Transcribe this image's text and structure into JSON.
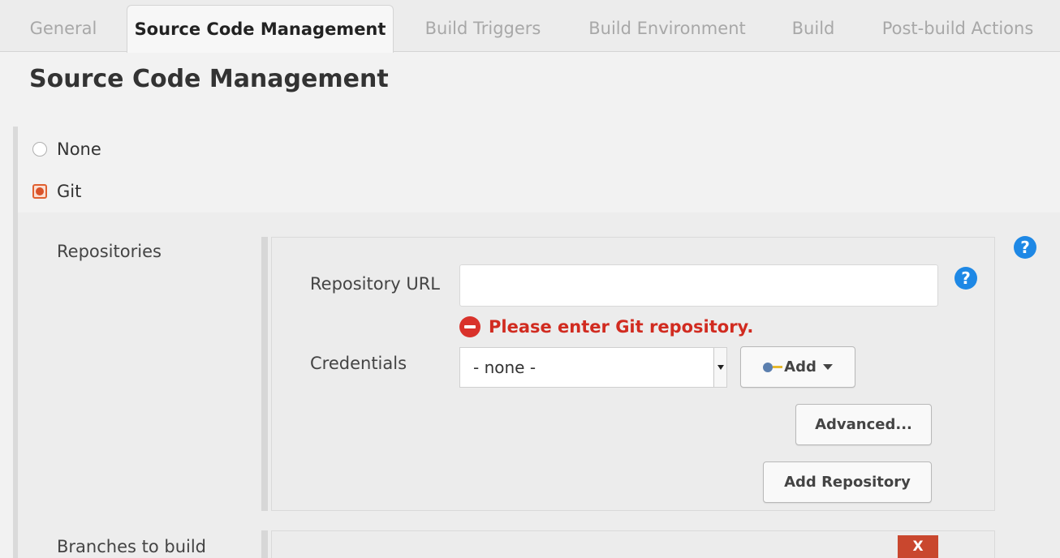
{
  "tabs": [
    {
      "label": "General",
      "active": false
    },
    {
      "label": "Source Code Management",
      "active": true
    },
    {
      "label": "Build Triggers",
      "active": false
    },
    {
      "label": "Build Environment",
      "active": false
    },
    {
      "label": "Build",
      "active": false
    },
    {
      "label": "Post-build Actions",
      "active": false
    }
  ],
  "section": {
    "title": "Source Code Management",
    "options": [
      {
        "label": "None",
        "selected": false
      },
      {
        "label": "Git",
        "selected": true
      }
    ]
  },
  "git": {
    "repositories_label": "Repositories",
    "repository_url": {
      "label": "Repository URL",
      "value": "",
      "error": "Please enter Git repository."
    },
    "credentials": {
      "label": "Credentials",
      "selected": "- none -",
      "add_label": "Add"
    },
    "advanced_label": "Advanced...",
    "add_repository_label": "Add Repository",
    "branches_label": "Branches to build",
    "delete_label": "X"
  },
  "icons": {
    "help": "?",
    "help_color": "#1e88e5",
    "error_color": "#d12b20"
  }
}
